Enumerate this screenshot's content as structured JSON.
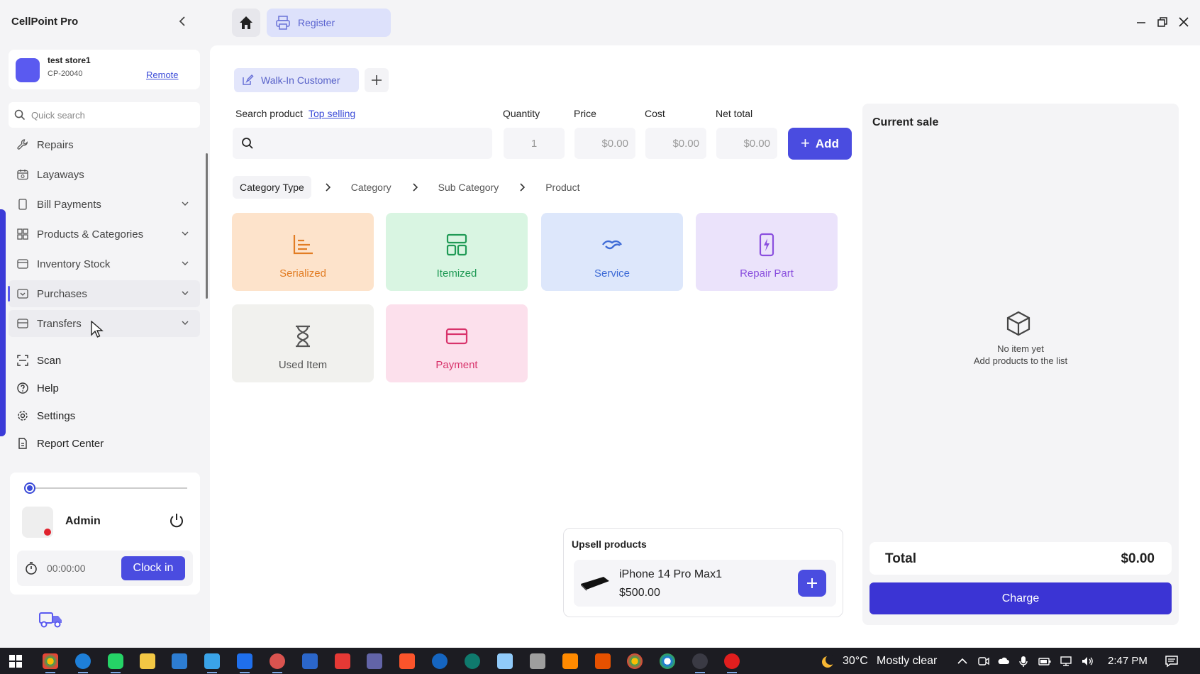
{
  "app": {
    "title": "CellPoint Pro"
  },
  "store": {
    "name": "test store1",
    "id": "CP-20040",
    "mode_link": "Remote"
  },
  "sidebar": {
    "search_placeholder": "Quick search",
    "items": [
      {
        "label": "Repairs",
        "icon": "wrench-icon"
      },
      {
        "label": "Layaways",
        "icon": "calendar-icon"
      },
      {
        "label": "Bill Payments",
        "icon": "bill-icon"
      },
      {
        "label": "Products & Categories",
        "icon": "grid-icon"
      },
      {
        "label": "Inventory Stock",
        "icon": "box-icon"
      },
      {
        "label": "Purchases",
        "icon": "purchase-icon"
      },
      {
        "label": "Transfers",
        "icon": "transfer-icon"
      }
    ],
    "bottom_items": [
      {
        "label": "Scan",
        "icon": "scan-icon"
      },
      {
        "label": "Help",
        "icon": "help-icon"
      },
      {
        "label": "Settings",
        "icon": "gear-icon"
      },
      {
        "label": "Report Center",
        "icon": "report-icon"
      }
    ]
  },
  "user": {
    "name": "Admin",
    "timer": "00:00:00",
    "clock_in_label": "Clock in"
  },
  "topbar": {
    "register_label": "Register"
  },
  "customer": {
    "tab_label": "Walk-In Customer"
  },
  "product_form": {
    "search_label": "Search product",
    "top_selling_link": "Top selling",
    "quantity_label": "Quantity",
    "price_label": "Price",
    "cost_label": "Cost",
    "net_total_label": "Net total",
    "quantity_value": "1",
    "price_value": "$0.00",
    "cost_value": "$0.00",
    "net_total_value": "$0.00",
    "add_label": "Add"
  },
  "breadcrumb": [
    "Category Type",
    "Category",
    "Sub Category",
    "Product"
  ],
  "tiles": [
    {
      "label": "Serialized",
      "icon": "bar-chart-icon",
      "color": "#e27d24"
    },
    {
      "label": "Itemized",
      "icon": "layout-icon",
      "color": "#1f9a55"
    },
    {
      "label": "Service",
      "icon": "handshake-icon",
      "color": "#3e6bd6"
    },
    {
      "label": "Repair Part",
      "icon": "phone-bolt-icon",
      "color": "#8a4fde"
    },
    {
      "label": "Used Item",
      "icon": "hourglass-icon",
      "color": "#555555"
    },
    {
      "label": "Payment",
      "icon": "credit-card-icon",
      "color": "#d8336b"
    }
  ],
  "upsell": {
    "title": "Upsell products",
    "product_name": "iPhone 14 Pro Max1",
    "product_price": "$500.00"
  },
  "sale": {
    "title": "Current sale",
    "empty_line1": "No item yet",
    "empty_line2": "Add products to the list",
    "total_label": "Total",
    "total_value": "$0.00",
    "charge_label": "Charge"
  },
  "taskbar": {
    "temperature": "30°C",
    "condition": "Mostly clear",
    "time": "2:47 PM"
  },
  "colors": {
    "accent": "#4a4ce0",
    "charge": "#3b34d4"
  }
}
